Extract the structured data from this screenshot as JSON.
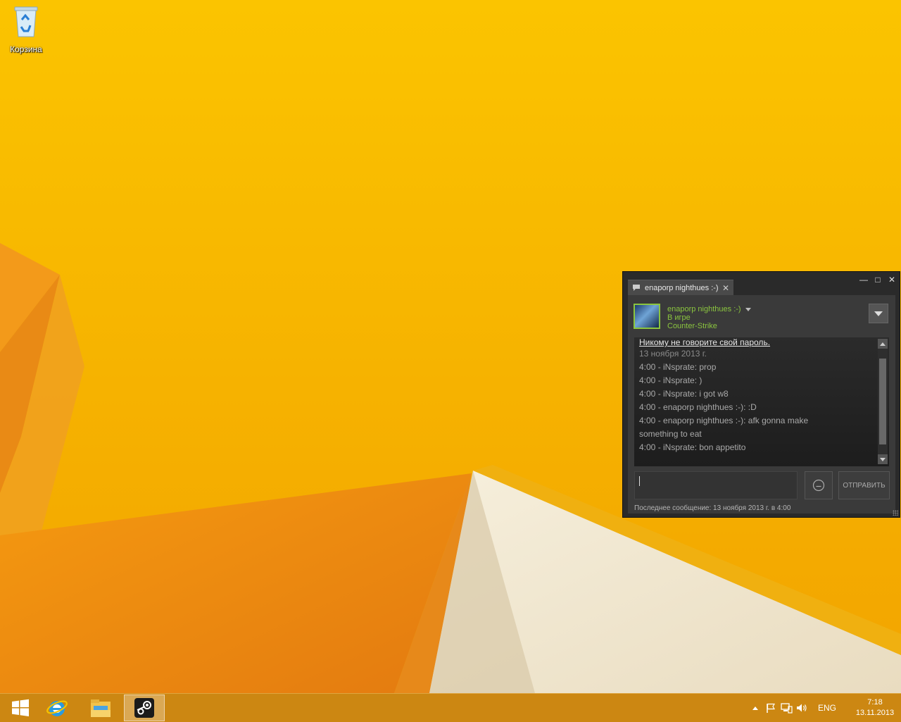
{
  "desktop": {
    "recycle_bin_label": "Корзина"
  },
  "chat": {
    "tab_label": "enaporp nighthues :-)",
    "friend": {
      "name": "enaporp nighthues :-)",
      "status": "В игре",
      "game": "Counter-Strike"
    },
    "messages": [
      "Никому не говорите свой пароль.",
      "13 ноября 2013 г.",
      "4:00 - iNsprate: prop",
      "4:00 - iNsprate: )",
      "4:00 - iNsprate: i got w8",
      "4:00 - enaporp nighthues :-): :D",
      "4:00 - enaporp nighthues :-): afk gonna make",
      "something to eat",
      "4:00 - iNsprate: bon appetito"
    ],
    "input_value": "",
    "send_label": "ОТПРАВИТЬ",
    "last_message": "Последнее сообщение: 13 ноября 2013 г. в 4:00",
    "colors": {
      "online_green": "#8bc53f",
      "window_bg": "#2a2a2a"
    }
  },
  "taskbar": {
    "items": [
      "start-icon",
      "internet-explorer-icon",
      "file-explorer-icon",
      "steam-icon"
    ],
    "active_item": "steam-icon",
    "tray_icons": [
      "show-hidden-icons",
      "action-center-flag-icon",
      "network-icon",
      "volume-icon"
    ],
    "language": "ENG",
    "time": "7:18",
    "date": "13.11.2013"
  },
  "wallpaper_colors": {
    "yellow": "#f6b800",
    "orange": "#f08a10",
    "cream": "#f2ead8"
  }
}
